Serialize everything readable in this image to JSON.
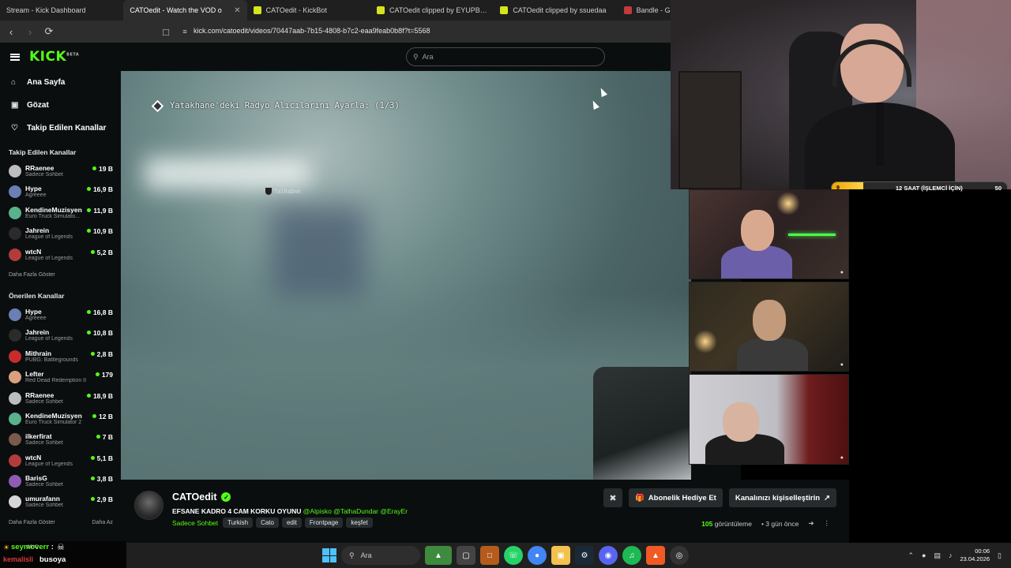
{
  "browser": {
    "tabs": [
      {
        "title": "Stream - Kick Dashboard",
        "fav": "kick",
        "active": false
      },
      {
        "title": "CATOedit - Watch the VOD o",
        "fav": "kick",
        "active": true
      },
      {
        "title": "CATOedit - KickBot",
        "fav": "kb",
        "active": false
      },
      {
        "title": "CATOedit clipped by EYUPB_UYDUR",
        "fav": "kb",
        "active": false
      },
      {
        "title": "CATOedit clipped by ssuedaa",
        "fav": "kb",
        "active": false
      },
      {
        "title": "Bandle - Guess the song,",
        "fav": "bd",
        "active": false
      }
    ],
    "url": "kick.com/catoedit/videos/70447aab-7b15-4808-b7c2-eaa9feab0b8f?t=5568"
  },
  "kick": {
    "logo": "KICK",
    "logo_sup": "BETA",
    "search_placeholder": "Ara",
    "nav": [
      {
        "label": "Ana Sayfa",
        "icon": "home-icon"
      },
      {
        "label": "Gözat",
        "icon": "browse-icon"
      },
      {
        "label": "Takip Edilen Kanallar",
        "icon": "heart-icon"
      }
    ],
    "followed_title": "Takip Edilen Kanallar",
    "followed": [
      {
        "name": "RRaenee",
        "category": "Sadece Sohbet",
        "viewers": "19 B",
        "color": "#bdbdbd"
      },
      {
        "name": "Hype",
        "category": "Agreeee",
        "viewers": "16,9 B",
        "color": "#6b7fb5"
      },
      {
        "name": "KendineMuzisyen",
        "category": "Euro Truck Simulato...",
        "viewers": "11,9 B",
        "color": "#58b28b"
      },
      {
        "name": "Jahrein",
        "category": "League of Legends",
        "viewers": "10,9 B",
        "color": "#2b2b2b"
      },
      {
        "name": "wtcN",
        "category": "League of Legends",
        "viewers": "5,2 B",
        "color": "#b23b3b"
      }
    ],
    "followed_more": "Daha Fazla Göster",
    "recommended_title": "Önerilen Kanallar",
    "recommended": [
      {
        "name": "Hype",
        "category": "Agreeee",
        "viewers": "16,8 B",
        "color": "#6b7fb5"
      },
      {
        "name": "Jahrein",
        "category": "League of Legends",
        "viewers": "10,8 B",
        "color": "#2b2b2b"
      },
      {
        "name": "Mithrain",
        "category": "PUBG: Battlegrounds",
        "viewers": "2,8 B",
        "color": "#c82b2b"
      },
      {
        "name": "Lefter",
        "category": "Red Dead Redemption II",
        "viewers": "179",
        "color": "#d9a07d"
      },
      {
        "name": "RRaenee",
        "category": "Sadece Sohbet",
        "viewers": "18,9 B",
        "color": "#bdbdbd"
      },
      {
        "name": "KendineMuzisyen",
        "category": "Euro Truck Simulator 2",
        "viewers": "12 B",
        "color": "#58b28b"
      },
      {
        "name": "ilkerfirat",
        "category": "Sadece Sohbet",
        "viewers": "7 B",
        "color": "#7a5a4a"
      },
      {
        "name": "wtcN",
        "category": "League of Legends",
        "viewers": "5,1 B",
        "color": "#b23b3b"
      },
      {
        "name": "BarisG",
        "category": "Sadece Sohbet",
        "viewers": "3,8 B",
        "color": "#8e5bb5"
      },
      {
        "name": "umurafann",
        "category": "Sadece Sohbet",
        "viewers": "2,9 B",
        "color": "#d6d6d6"
      }
    ],
    "recommended_more": "Daha Fazla Göster",
    "recommended_less": "Daha Az"
  },
  "video": {
    "objective": "Yatakhane'deki Radyo Alıcılarını Ayarla: (1/3)",
    "player_tag": "TalhaDnn"
  },
  "channel": {
    "name": "CATOedit",
    "title": "EFSANE KADRO 4 CAM KORKU OYUNU",
    "mentions": "@Alpisko @TalhaDundar @ErayEr",
    "category": "Sadece Sohbet",
    "tags": [
      "Turkish",
      "Cato",
      "edit",
      "Frontpage",
      "keşfet"
    ],
    "gift_label": "Abonelik Hediye Et",
    "customize_label": "Kanalınızı kişiselleştirin",
    "views_count": "105",
    "views_label": "görüntüleme",
    "age": "3 gün önce"
  },
  "overlay": {
    "timer_left": "9",
    "timer_text": "12 SAAT (İŞLEMCİ İÇİN)",
    "timer_right": "50",
    "timer_progress": 0.18
  },
  "chat": {
    "user1": "seymoverr",
    "user2": "kemalisli",
    "message": "busoya",
    "weather": "19°C"
  },
  "taskbar": {
    "search": "Ara",
    "time": "00:06",
    "date": "23.04.2026"
  }
}
